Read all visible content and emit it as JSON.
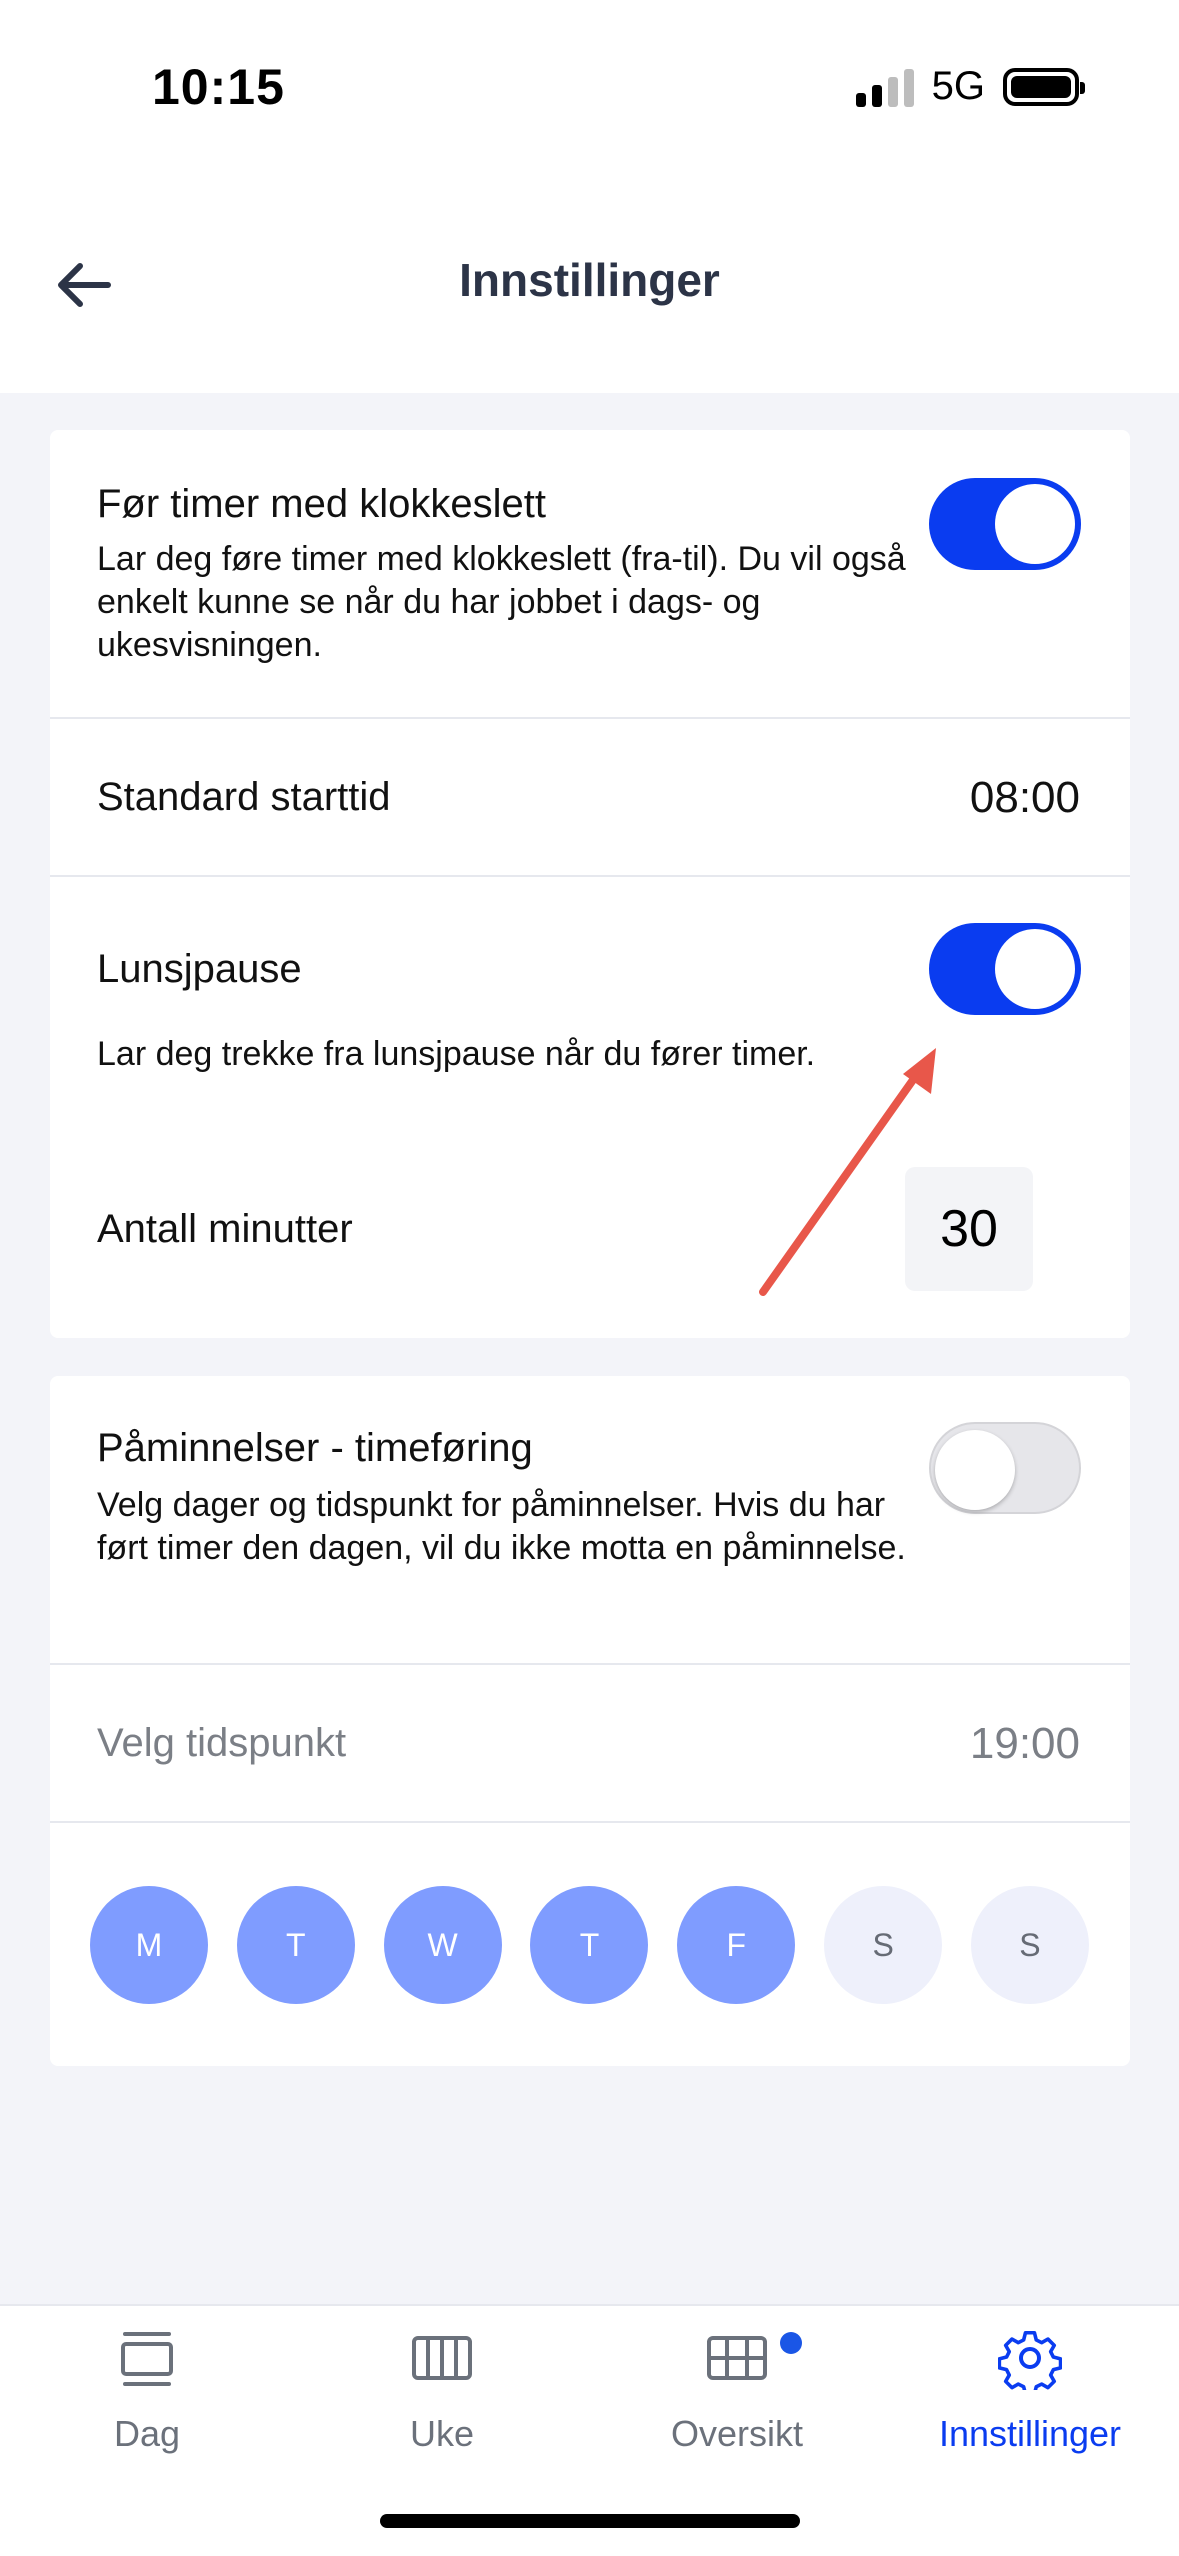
{
  "status_bar": {
    "time": "10:15",
    "network": "5G"
  },
  "header": {
    "title": "Innstillinger"
  },
  "timer_settings": {
    "clock_title": "Før timer med klokkeslett",
    "clock_desc": "Lar deg føre timer med klokkeslett (fra-til). Du vil også enkelt kunne se når du har jobbet i dags- og ukesvisningen.",
    "clock_enabled": true,
    "start_label": "Standard starttid",
    "start_value": "08:00",
    "lunch_title": "Lunsjpause",
    "lunch_desc": "Lar deg trekke fra lunsjpause når du fører timer.",
    "lunch_enabled": true,
    "minutes_label": "Antall minutter",
    "minutes_value": "30"
  },
  "reminders": {
    "title": "Påminnelser - timeføring",
    "desc": "Velg dager og tidspunkt for påminnelser. Hvis du har ført timer den dagen, vil du ikke motta en påminnelse.",
    "enabled": false,
    "time_label": "Velg tidspunkt",
    "time_value": "19:00",
    "days": [
      {
        "label": "M",
        "active": true
      },
      {
        "label": "T",
        "active": true
      },
      {
        "label": "W",
        "active": true
      },
      {
        "label": "T",
        "active": true
      },
      {
        "label": "F",
        "active": true
      },
      {
        "label": "S",
        "active": false
      },
      {
        "label": "S",
        "active": false
      }
    ]
  },
  "tabs": [
    {
      "label": "Dag",
      "icon": "day-view-icon"
    },
    {
      "label": "Uke",
      "icon": "week-view-icon"
    },
    {
      "label": "Oversikt",
      "icon": "grid-overview-icon"
    },
    {
      "label": "Innstillinger",
      "icon": "gear-icon",
      "active": true
    }
  ],
  "colors": {
    "accent": "#0a3cf0",
    "day_active": "#7f9cff",
    "day_inactive": "#eef0fb",
    "arrow": "#e8574a"
  }
}
